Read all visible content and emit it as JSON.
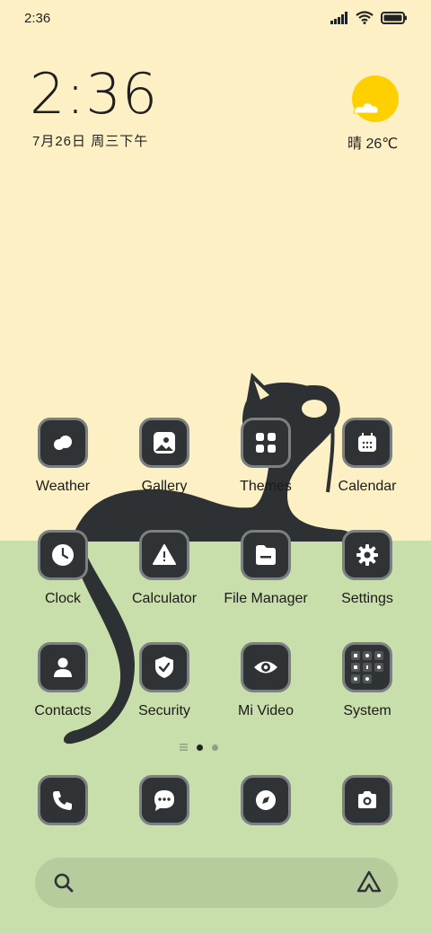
{
  "status": {
    "time": "2:36"
  },
  "clock": {
    "time": "2:36",
    "date": "7月26日 周三下午"
  },
  "weather": {
    "text": "晴 26℃",
    "icon": "sun-cloud-icon"
  },
  "apps": [
    {
      "label": "Weather",
      "icon": "weather-icon"
    },
    {
      "label": "Gallery",
      "icon": "gallery-icon"
    },
    {
      "label": "Themes",
      "icon": "themes-icon"
    },
    {
      "label": "Calendar",
      "icon": "calendar-icon"
    },
    {
      "label": "Clock",
      "icon": "clock-icon"
    },
    {
      "label": "Calculator",
      "icon": "calculator-icon"
    },
    {
      "label": "File Manager",
      "icon": "file-manager-icon"
    },
    {
      "label": "Settings",
      "icon": "gear-icon"
    },
    {
      "label": "Contacts",
      "icon": "contact-icon"
    },
    {
      "label": "Security",
      "icon": "shield-icon"
    },
    {
      "label": "Mi Video",
      "icon": "eye-icon"
    },
    {
      "label": "System",
      "icon": "folder-icon"
    }
  ],
  "dock": [
    {
      "icon": "phone-icon"
    },
    {
      "icon": "message-icon"
    },
    {
      "icon": "compass-icon"
    },
    {
      "icon": "camera-icon"
    }
  ],
  "pages": {
    "count": 2,
    "active": 1
  },
  "colors": {
    "top_bg": "#fdf0c4",
    "bottom_bg": "#c8deab",
    "icon_bg": "#2f3335",
    "icon_border": "#7c8080",
    "sun": "#ffd000"
  }
}
